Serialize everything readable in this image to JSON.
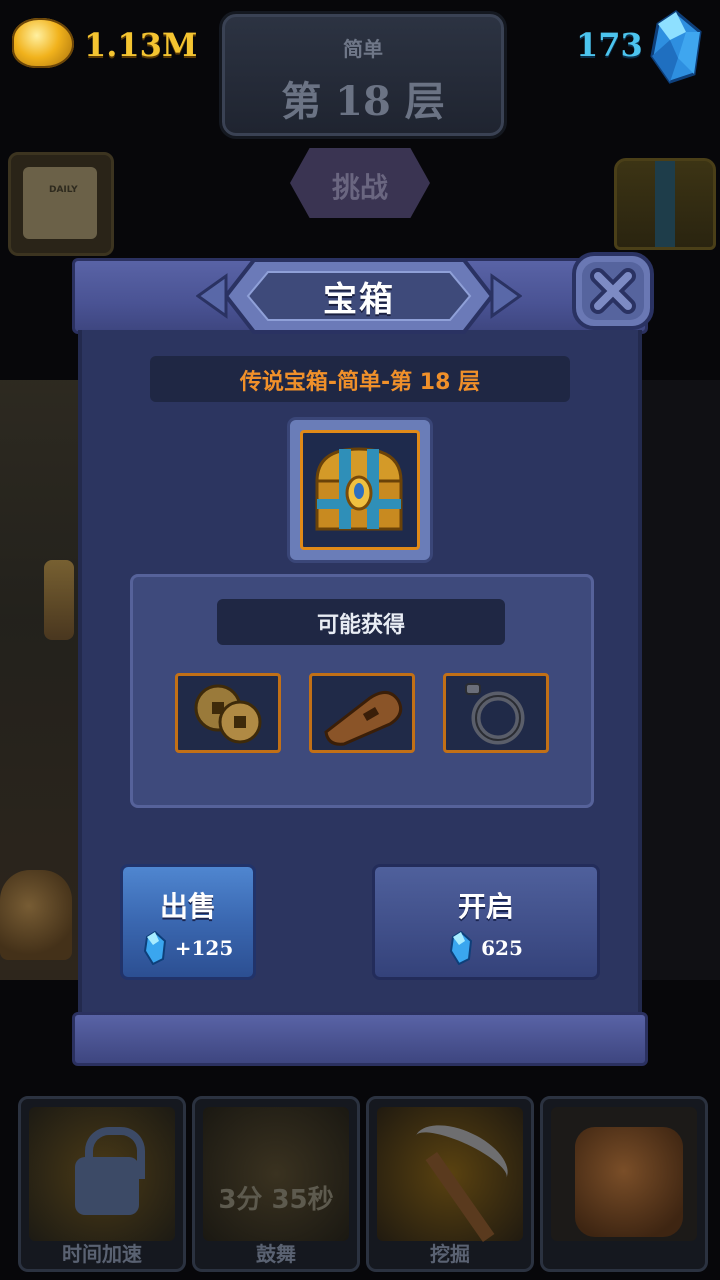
{
  "hud": {
    "gold_amount": "1.13M",
    "gem_count": "173",
    "floor_difficulty": "简单",
    "floor_label": "第 18 层",
    "challenge_label": "挑战",
    "daily_label": "DAILY"
  },
  "modal": {
    "title": "宝箱",
    "subtitle": "传说宝箱-简单-第 18 层",
    "rewards_header": "可能获得",
    "rewards": [
      {
        "icon": "coins-icon"
      },
      {
        "icon": "whistle-icon"
      },
      {
        "icon": "shackle-icon"
      }
    ],
    "sell": {
      "label": "出售",
      "price": "+125"
    },
    "open": {
      "label": "开启",
      "price": "625"
    }
  },
  "bottom_bar": {
    "items": [
      {
        "label": "时间加速",
        "icon": "lock-icon"
      },
      {
        "label": "鼓舞",
        "icon": "dwarf-silhouette-icon",
        "timer": "3分 35秒"
      },
      {
        "label": "挖掘",
        "icon": "pickaxe-icon"
      },
      {
        "label": "",
        "icon": "backpack-icon"
      }
    ]
  },
  "colors": {
    "gold": "#f4c431",
    "gem": "#4cc4ee",
    "subtitle": "#f0902a",
    "modal_bg": "#2c3560"
  }
}
